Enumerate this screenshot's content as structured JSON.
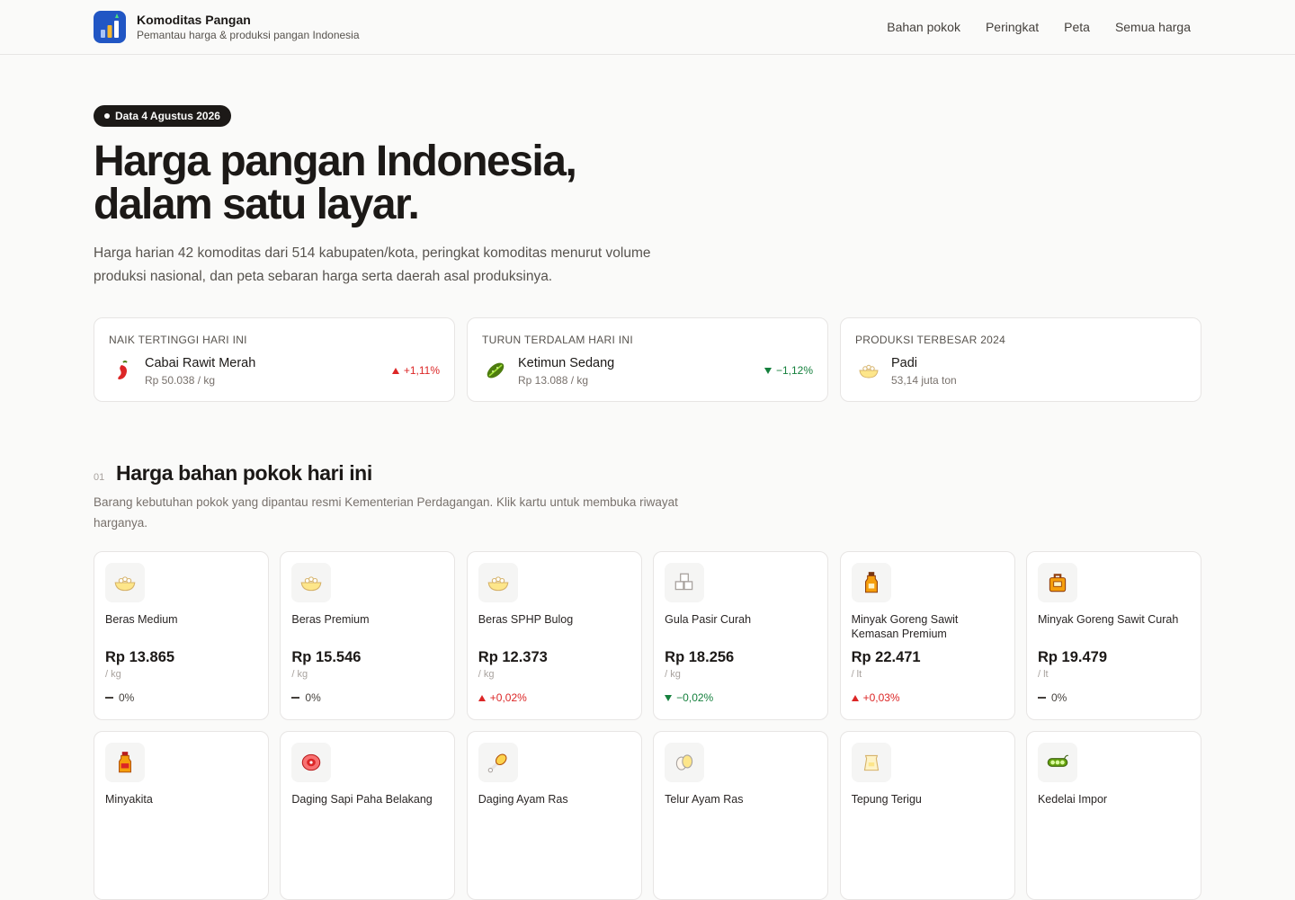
{
  "header": {
    "title": "Komoditas Pangan",
    "subtitle": "Pemantau harga & produksi pangan Indonesia",
    "nav": [
      "Bahan pokok",
      "Peringkat",
      "Peta",
      "Semua harga"
    ]
  },
  "hero": {
    "date_badge": "Data 4 Agustus 2026",
    "title_line1": "Harga pangan Indonesia,",
    "title_line2": "dalam satu layar.",
    "description": "Harga harian 42 komoditas dari 514 kabupaten/kota, peringkat komoditas menurut volume produksi nasional, dan peta sebaran harga serta daerah asal produksinya."
  },
  "highlights": [
    {
      "label": "NAIK TERTINGGI HARI INI",
      "name": "Cabai Rawit Merah",
      "sub": "Rp 50.038 / kg",
      "change": "+1,11%",
      "direction": "up",
      "icon": "chili-icon"
    },
    {
      "label": "TURUN TERDALAM HARI INI",
      "name": "Ketimun Sedang",
      "sub": "Rp 13.088 / kg",
      "change": "−1,12%",
      "direction": "down",
      "icon": "cucumber-icon"
    },
    {
      "label": "PRODUKSI TERBESAR 2024",
      "name": "Padi",
      "sub": "53,14 juta ton",
      "change": "",
      "direction": "none",
      "icon": "rice-bowl-icon"
    }
  ],
  "section": {
    "number": "01",
    "title": "Harga bahan pokok hari ini",
    "description": "Barang kebutuhan pokok yang dipantau resmi Kementerian Perdagangan. Klik kartu untuk membuka riwayat harganya."
  },
  "products": [
    {
      "name": "Beras Medium",
      "price": "Rp 13.865",
      "unit": "/ kg",
      "change": "0%",
      "direction": "flat",
      "icon": "rice-bowl-icon"
    },
    {
      "name": "Beras Premium",
      "price": "Rp 15.546",
      "unit": "/ kg",
      "change": "0%",
      "direction": "flat",
      "icon": "rice-bowl-icon"
    },
    {
      "name": "Beras SPHP Bulog",
      "price": "Rp 12.373",
      "unit": "/ kg",
      "change": "+0,02%",
      "direction": "up",
      "icon": "rice-bowl-icon"
    },
    {
      "name": "Gula Pasir Curah",
      "price": "Rp 18.256",
      "unit": "/ kg",
      "change": "−0,02%",
      "direction": "down",
      "icon": "sugar-cubes-icon"
    },
    {
      "name": "Minyak Goreng Sawit Kemasan Premium",
      "price": "Rp 22.471",
      "unit": "/ lt",
      "change": "+0,03%",
      "direction": "up",
      "icon": "oil-bottle-icon"
    },
    {
      "name": "Minyak Goreng Sawit Curah",
      "price": "Rp 19.479",
      "unit": "/ lt",
      "change": "0%",
      "direction": "flat",
      "icon": "oil-jerrycan-icon"
    },
    {
      "name": "Minyakita",
      "price": "",
      "unit": "",
      "change": "",
      "direction": "none",
      "icon": "minyakita-bottle-icon"
    },
    {
      "name": "Daging Sapi Paha Belakang",
      "price": "",
      "unit": "",
      "change": "",
      "direction": "none",
      "icon": "beef-icon"
    },
    {
      "name": "Daging Ayam Ras",
      "price": "",
      "unit": "",
      "change": "",
      "direction": "none",
      "icon": "chicken-leg-icon"
    },
    {
      "name": "Telur Ayam Ras",
      "price": "",
      "unit": "",
      "change": "",
      "direction": "none",
      "icon": "eggs-icon"
    },
    {
      "name": "Tepung Terigu",
      "price": "",
      "unit": "",
      "change": "",
      "direction": "none",
      "icon": "flour-bag-icon"
    },
    {
      "name": "Kedelai Impor",
      "price": "",
      "unit": "",
      "change": "",
      "direction": "none",
      "icon": "soybean-icon"
    }
  ],
  "colors": {
    "up": "#dc2626",
    "down": "#15803d",
    "logo": "#2156c4",
    "dark": "#1c1917"
  }
}
